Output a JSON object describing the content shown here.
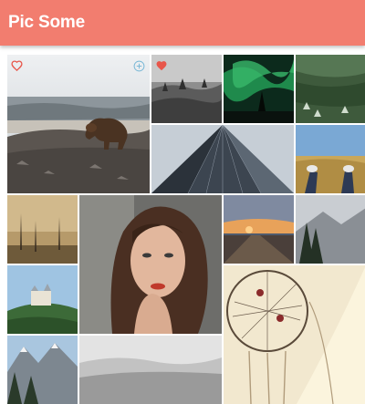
{
  "app": {
    "title": "Pic Some"
  },
  "colors": {
    "header": "#f27d6f",
    "heart_outline": "#e8564a",
    "heart_filled": "#e8564a",
    "plus_outline": "#7ab8d6"
  },
  "photos": [
    {
      "name": "bear-on-rocks",
      "favorited": false,
      "hover_add": true
    },
    {
      "name": "misty-forest",
      "favorited": true
    },
    {
      "name": "aurora-night",
      "favorited": false
    },
    {
      "name": "pine-forest-aerial",
      "favorited": false
    },
    {
      "name": "skyscraper-upward",
      "favorited": false
    },
    {
      "name": "feet-in-field",
      "favorited": false
    },
    {
      "name": "foggy-dead-trees",
      "favorited": false
    },
    {
      "name": "woman-portrait",
      "favorited": false
    },
    {
      "name": "city-sunset",
      "favorited": false
    },
    {
      "name": "mountain-pines",
      "favorited": false
    },
    {
      "name": "castle-on-hill",
      "favorited": false
    },
    {
      "name": "dreamcatcher",
      "favorited": false
    },
    {
      "name": "snowy-peaks",
      "favorited": false
    },
    {
      "name": "fog-hills",
      "favorited": false
    }
  ]
}
